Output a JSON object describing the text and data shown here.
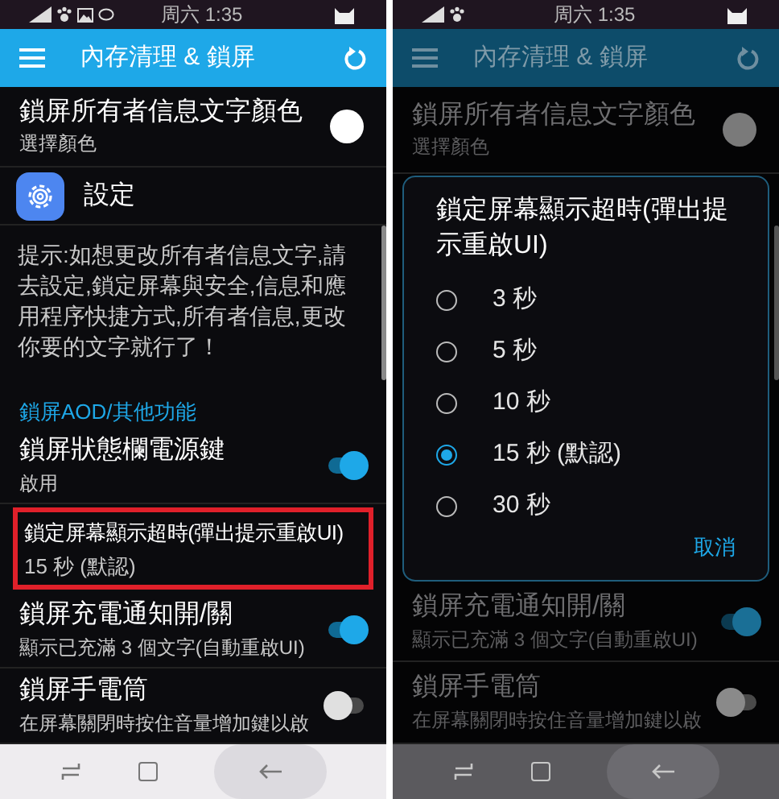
{
  "screens": [
    {
      "dimmed": false,
      "status_bar": {
        "time": "周六 1:35",
        "extra_icons": true
      },
      "app_bar": {
        "title": "內存清理 & 鎖屏"
      },
      "items": [
        {
          "kind": "color",
          "title": "鎖屏所有者信息文字顏色",
          "subtitle": "選擇顏色"
        },
        {
          "kind": "link",
          "title": "設定"
        },
        {
          "kind": "note",
          "text": "提示:如想更改所有者信息文字,請去設定,鎖定屏幕與安全,信息和應用程序快捷方式,所有者信息,更改你要的文字就行了！"
        },
        {
          "kind": "header",
          "text": "鎖屏AOD/其他功能"
        },
        {
          "kind": "toggle",
          "title": "鎖屏狀態欄電源鍵",
          "subtitle": "啟用",
          "on": true
        },
        {
          "kind": "value",
          "title": "鎖定屏幕顯示超時(彈出提示重啟UI)",
          "subtitle": "15 秒 (默認)",
          "highlighted": true
        },
        {
          "kind": "toggle",
          "title": "鎖屏充電通知開/關",
          "subtitle": "顯示已充滿 3 個文字(自動重啟UI)",
          "on": true
        },
        {
          "kind": "toggle",
          "title": "鎖屏手電筒",
          "subtitle": "在屏幕關閉時按住音量增加鍵以啟",
          "on": false
        }
      ]
    },
    {
      "dimmed": true,
      "status_bar": {
        "time": "周六 1:35",
        "extra_icons": false
      },
      "app_bar": {
        "title": "內存清理 & 鎖屏"
      },
      "items": [
        {
          "kind": "color",
          "title": "鎖屏所有者信息文字顏色",
          "subtitle": "選擇顏色"
        },
        {
          "kind": "dialog",
          "title": "鎖定屏幕顯示超時(彈出提示重啟UI)",
          "options": [
            {
              "label": "3 秒",
              "selected": false
            },
            {
              "label": "5 秒",
              "selected": false
            },
            {
              "label": "10 秒",
              "selected": false
            },
            {
              "label": "15 秒 (默認)",
              "selected": true
            },
            {
              "label": "30 秒",
              "selected": false
            }
          ],
          "cancel": "取消"
        },
        {
          "kind": "toggle",
          "title": "鎖屏充電通知開/關",
          "subtitle": "顯示已充滿 3 個文字(自動重啟UI)",
          "on": true
        },
        {
          "kind": "toggle",
          "title": "鎖屏手電筒",
          "subtitle": "在屏幕關閉時按住音量增加鍵以啟",
          "on": false
        }
      ]
    }
  ]
}
